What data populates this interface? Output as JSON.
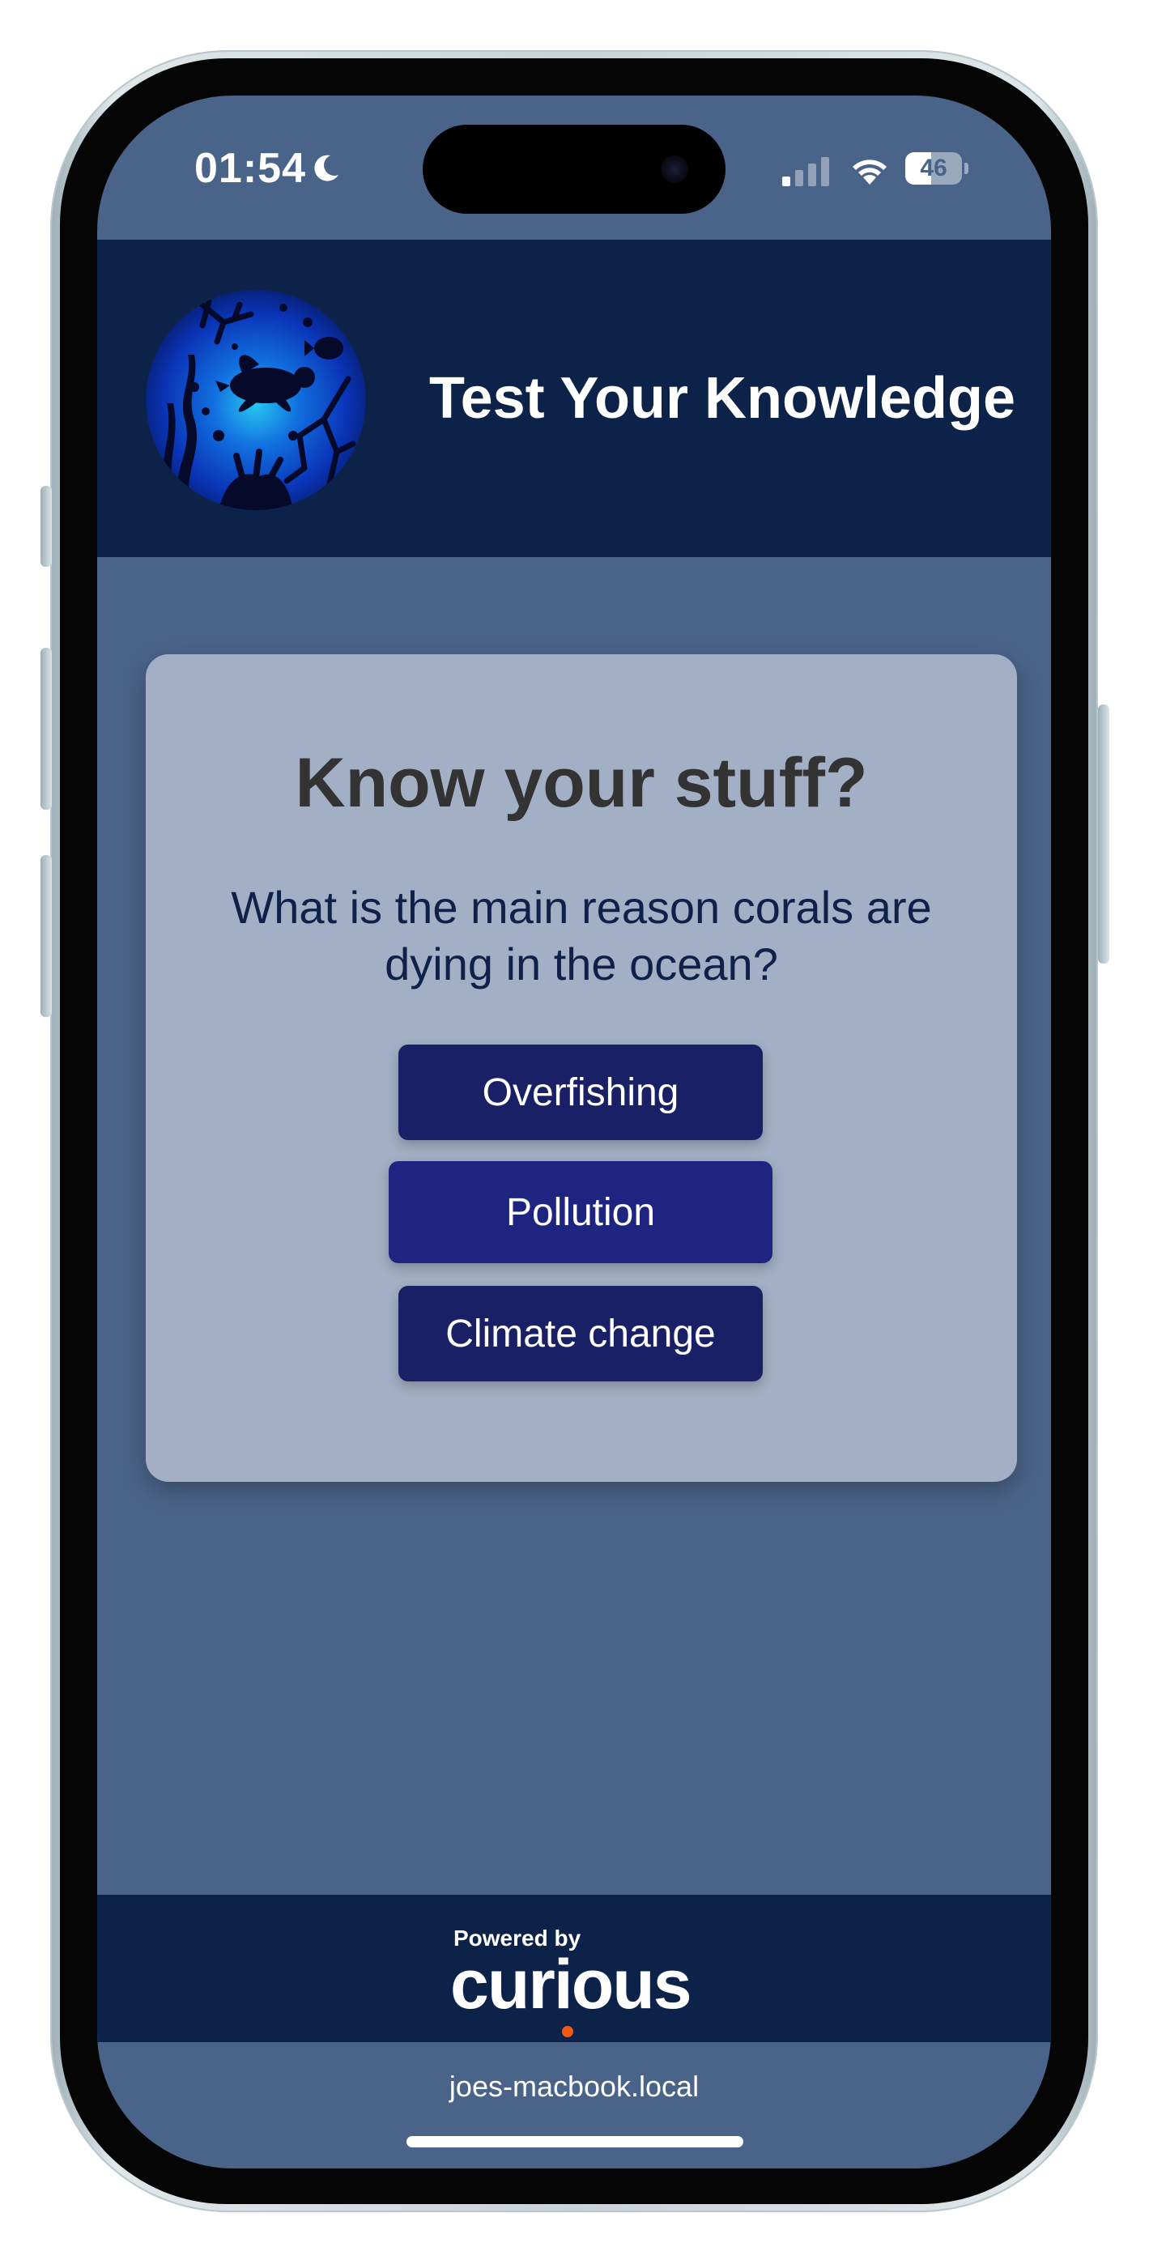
{
  "status_bar": {
    "time": "01:54",
    "battery": "46",
    "battery_level_percent": 46
  },
  "header": {
    "title": "Test Your Knowledge",
    "logo_icon": "ocean-turtle-logo-icon"
  },
  "quiz": {
    "heading": "Know your stuff?",
    "question": "What is the main reason corals are dying in the ocean?",
    "answers": [
      {
        "label": "Overfishing"
      },
      {
        "label": "Pollution"
      },
      {
        "label": "Climate change"
      }
    ]
  },
  "footer": {
    "powered_by": "Powered by",
    "brand": "curious",
    "brand_dot_color": "#f05a14"
  },
  "browser": {
    "url": "joes-macbook.local"
  },
  "colors": {
    "screen_background": "#4a6388",
    "header_background": "#0c2249",
    "card_background": "#a2afc4",
    "button_background": "#1a2065"
  }
}
